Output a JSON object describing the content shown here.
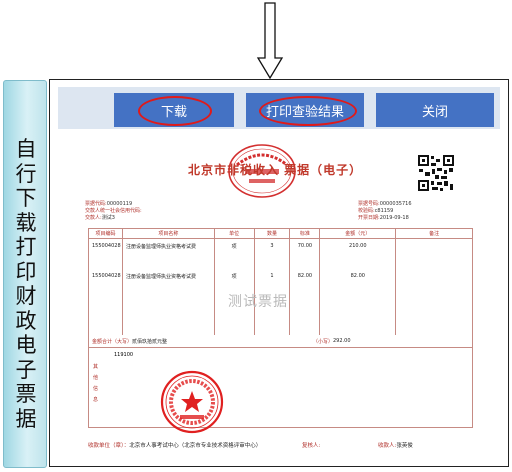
{
  "side_panel": {
    "text": "自行下载 打印财政电子票据"
  },
  "toolbar": {
    "download_label": "下载",
    "print_label": "打印查验结果",
    "close_label": "关闭"
  },
  "receipt": {
    "title": "北京市非税收入 票据（电子）",
    "seal_top_text": "北京市财政局 财政票据监制章",
    "left_info": {
      "code_label": "票据代码:",
      "code_value": "00000119",
      "payer_code_label": "交款人统一社会信用代码:",
      "payer_code_value": "",
      "payer_label": "交款人:",
      "payer_value": "测试3"
    },
    "right_info": {
      "number_label": "票据号码:",
      "number_value": "0000035716",
      "check_label": "校验码:",
      "check_value": "c81159",
      "date_label": "开票日期:",
      "date_value": "2019-09-18"
    },
    "table": {
      "headers": [
        "项目编码",
        "项目名称",
        "单位",
        "数量",
        "标准",
        "金额（元）",
        "备注"
      ],
      "rows": [
        {
          "code": "155004028",
          "name": "注册设备监理师执业资格考试费",
          "unit": "项",
          "qty": "3",
          "std": "70.00",
          "amount": "210.00",
          "note": ""
        },
        {
          "code": "155004028",
          "name": "注册设备监理师执业资格考试费",
          "unit": "项",
          "qty": "1",
          "std": "82.00",
          "amount": "82.00",
          "note": ""
        }
      ]
    },
    "watermark": "测试票据",
    "total_label": "金额合计（大写）",
    "total_words": "贰佰玖拾贰元整",
    "total_small_label": "（小写）",
    "total_small_value": "292.00",
    "remark_label": "其他信息",
    "remark_code": "119100",
    "footer": {
      "payee_unit_label": "收款单位（章）：",
      "payee_unit_value": "北京市人事考试中心（北京市专业技术资格评审中心）",
      "reviewer_label": "复核人:",
      "reviewer_value": "",
      "collector_label": "收款人:",
      "collector_value": "张英俊"
    }
  },
  "colors": {
    "button_bg": "#4472c4",
    "toolbar_bg": "#dde6f1",
    "highlight_ring": "#e01a1a",
    "receipt_red": "#c0392b",
    "side_panel": "#bfe4ec"
  }
}
